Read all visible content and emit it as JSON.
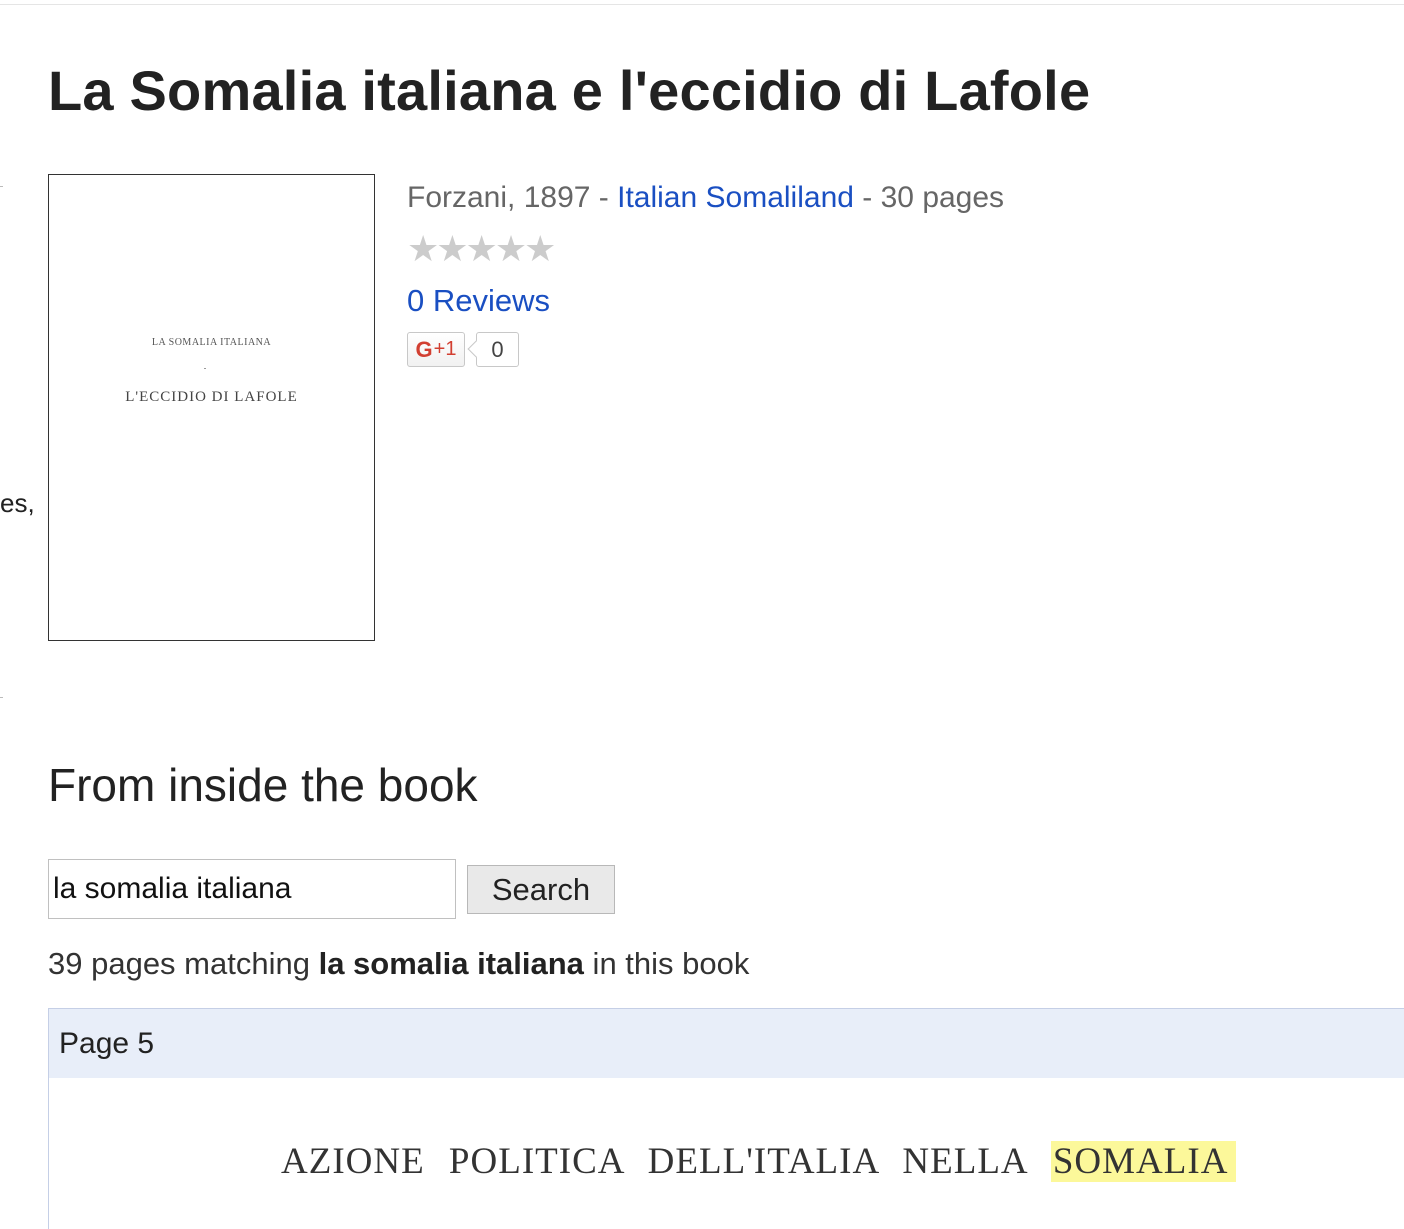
{
  "book": {
    "title": "La Somalia italiana e l'eccidio di Lafole",
    "cover": {
      "line1": "LA SOMALIA ITALIANA",
      "line2": "L'ECCIDIO DI LAFOLE"
    },
    "meta": {
      "publisher_year": "Forzani, 1897",
      "sep1": " - ",
      "subject": "Italian Somaliland",
      "sep2": " - ",
      "pages": "30 pages"
    },
    "rating_stars": "★★★★★",
    "reviews_label": "0 Reviews",
    "gplus": {
      "label": "G",
      "plus": "+1",
      "count": "0"
    }
  },
  "left_clip_text": "es,",
  "inside": {
    "heading": "From inside the book",
    "search": {
      "value": "la somalia italiana",
      "button_label": "Search"
    },
    "summary": {
      "prefix": "39 pages matching ",
      "query": "la somalia italiana",
      "suffix": " in this book"
    },
    "results": [
      {
        "page_label": "Page 5",
        "snippet_text": "AZIONE POLITICA DELL'ITALIA NELLA",
        "snippet_highlight": "SOMALIA"
      }
    ]
  },
  "colors": {
    "link": "#1a4fc2",
    "result_header_bg": "#e8eef9",
    "highlight": "#fcf89a",
    "gplus_red": "#d23f31"
  }
}
